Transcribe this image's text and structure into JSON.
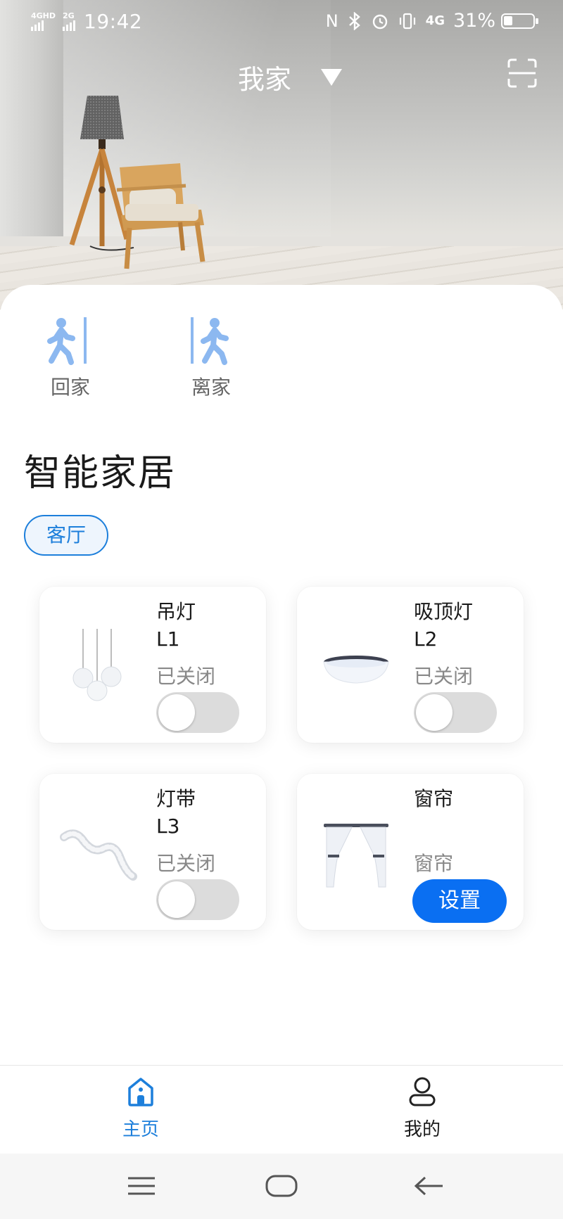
{
  "status_bar": {
    "network1": "4GHD",
    "network2": "2G",
    "time": "19:42",
    "nfc": "N",
    "lte": "4G",
    "battery_text": "31%",
    "battery_level": 0.31
  },
  "header": {
    "home_name": "我家",
    "dropdown_icon": "triangle-down-icon",
    "scan_icon": "scan-frame-icon"
  },
  "scenes": [
    {
      "label": "回家",
      "icon": "walk-in-icon"
    },
    {
      "label": "离家",
      "icon": "walk-out-icon"
    }
  ],
  "section": {
    "title": "智能家居",
    "room_chip": "客厅"
  },
  "devices": [
    {
      "name": "吊灯",
      "code": "L1",
      "state": "已关闭",
      "control": "toggle",
      "on": false,
      "icon": "pendant-lamp-icon"
    },
    {
      "name": "吸顶灯",
      "code": "L2",
      "state": "已关闭",
      "control": "toggle",
      "on": false,
      "icon": "ceiling-lamp-icon"
    },
    {
      "name": "灯带",
      "code": "L3",
      "state": "已关闭",
      "control": "toggle",
      "on": false,
      "icon": "light-strip-icon"
    },
    {
      "name": "窗帘",
      "code": "",
      "state": "窗帘",
      "control": "button",
      "button_label": "设置",
      "icon": "curtain-icon"
    }
  ],
  "bottom_nav": {
    "home_label": "主页",
    "me_label": "我的"
  },
  "colors": {
    "accent": "#1d7fdb",
    "button_blue": "#0a6ff2",
    "scene_icon": "#8cb8f0",
    "toggle_off": "#dcdcdc"
  }
}
